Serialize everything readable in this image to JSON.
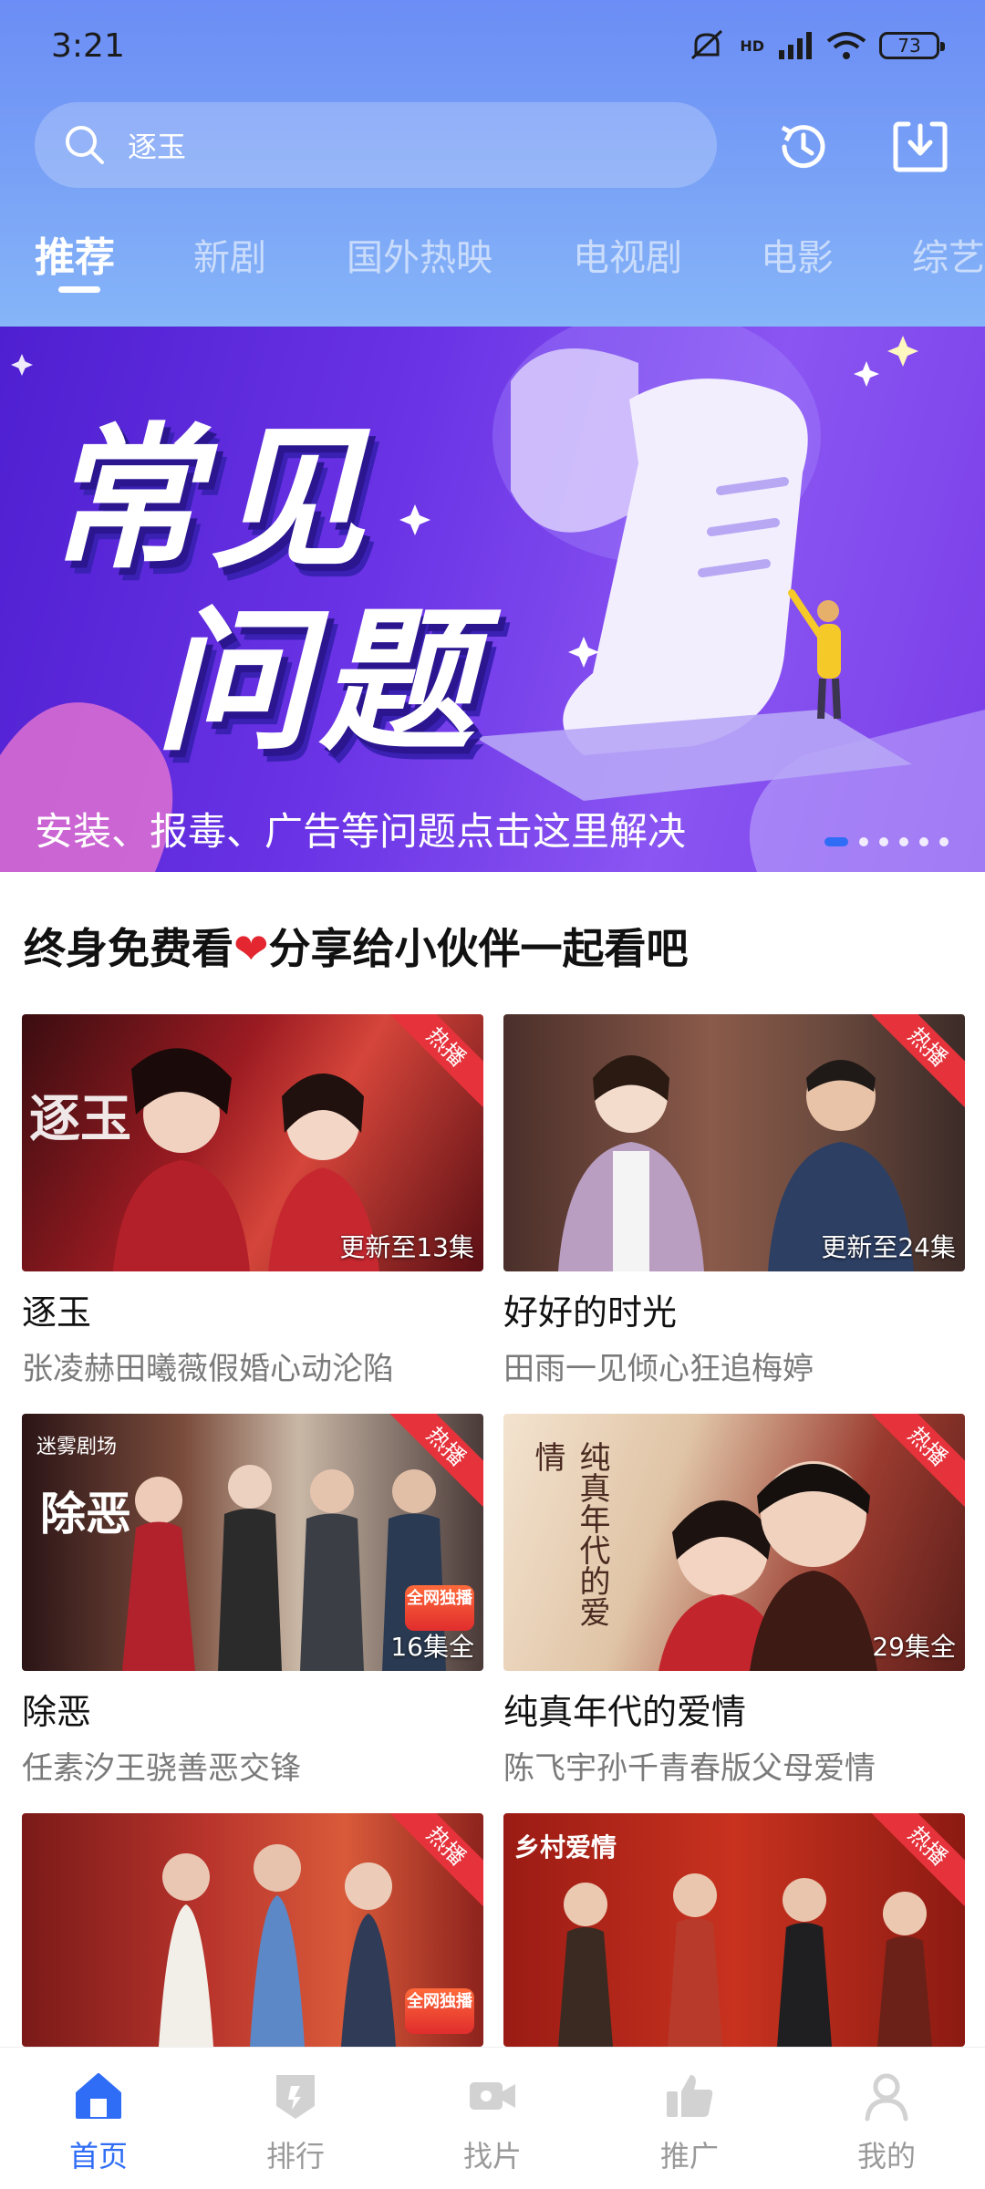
{
  "status_bar": {
    "time": "3:21",
    "battery": "73",
    "network": "HD"
  },
  "search": {
    "value": "逐玉",
    "placeholder": "逐玉"
  },
  "header": {
    "history_icon": "history-icon",
    "download_icon": "download-icon"
  },
  "tabs": [
    {
      "label": "推荐",
      "active": true
    },
    {
      "label": "新剧"
    },
    {
      "label": "国外热映"
    },
    {
      "label": "电视剧"
    },
    {
      "label": "电影"
    },
    {
      "label": "综艺"
    }
  ],
  "banner": {
    "title_line1": "常见",
    "title_line2": "问题",
    "caption": "安装、报毒、广告等问题点击这里解决",
    "dots": 6,
    "active_dot": 0
  },
  "section": {
    "title_prefix": "终身免费看",
    "heart": "❤",
    "title_suffix": "分享给小伙伴一起看吧"
  },
  "colors": {
    "accent": "#2f6df6",
    "ribbon": "#e6323b",
    "header_top": "#6b8df5"
  },
  "cards": [
    {
      "title": "逐玉",
      "subtitle": "张凌赫田曦薇假婚心动沦陷",
      "badge": "热播",
      "episodes": "更新至13集",
      "poster_text": "逐玉"
    },
    {
      "title": "好好的时光",
      "subtitle": "田雨一见倾心狂追梅婷",
      "badge": "热播",
      "episodes": "更新至24集",
      "poster_text": ""
    },
    {
      "title": "除恶",
      "subtitle": "任素汐王骁善恶交锋",
      "badge": "热播",
      "episodes": "16集全",
      "poster_text": "除恶",
      "poster_logo": "迷雾剧场",
      "exclusive": "全网独播"
    },
    {
      "title": "纯真年代的爱情",
      "subtitle": "陈飞宇孙千青春版父母爱情",
      "badge": "热播",
      "episodes": "29集全",
      "poster_text": "纯真年代的爱情"
    },
    {
      "title": "",
      "subtitle": "",
      "badge": "热播",
      "episodes": "",
      "poster_text": "",
      "exclusive": "全网独播"
    },
    {
      "title": "",
      "subtitle": "",
      "badge": "热播",
      "episodes": "",
      "poster_text": "乡村爱情"
    }
  ],
  "bottom_nav": [
    {
      "label": "首页",
      "icon": "home-icon",
      "active": true
    },
    {
      "label": "排行",
      "icon": "ranking-icon"
    },
    {
      "label": "找片",
      "icon": "video-camera-icon"
    },
    {
      "label": "推广",
      "icon": "thumbs-up-icon"
    },
    {
      "label": "我的",
      "icon": "profile-icon"
    }
  ]
}
